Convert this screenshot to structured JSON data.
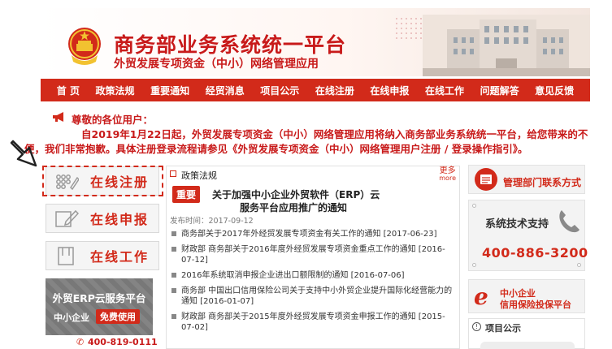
{
  "header": {
    "title": "商务部业务系统统一平台",
    "subtitle": "外贸发展专项资金（中小）网络管理应用"
  },
  "nav": {
    "items": [
      "首 页",
      "政策法规",
      "重要通知",
      "经贸消息",
      "项目公示",
      "在线注册",
      "在线申报",
      "在线工作",
      "问题解答",
      "意见反馈"
    ]
  },
  "notice": {
    "greeting": "尊敬的各位用户：",
    "line1": "自2019年1月22日起，外贸发展专项资金（中小）网络管理应用将纳入商务部业务系统统一平台，给您带来的不",
    "line2": "便，我们非常抱歉。具体注册登录流程请参见《外贸发展专项资金（中小）网络管理用户注册 / 登录操作指引》。"
  },
  "sidebar": {
    "register": "在线注册",
    "apply": "在线申报",
    "work": "在线工作"
  },
  "erp_banner": {
    "title": "外贸ERP云服务平台",
    "sme": "中小企业",
    "free": "免费使用",
    "phone": "400-819-0111"
  },
  "policy": {
    "heading": "政策法规",
    "more_cn": "更多",
    "more_en": "more",
    "badge": "重要",
    "headline_line1": "关于加强中小企业外贸软件（ERP）云",
    "headline_line2": "服务平台应用推广的通知",
    "pubdate": "发布时间：2017-09-12",
    "items": [
      "商务部关于2017年外经贸发展专项资金有关工作的通知 [2017-06-23]",
      "财政部 商务部关于2016年度外经贸发展专项资金重点工作的通知 [2016-07-12]",
      "2016年系统取消申报企业进出口额限制的通知 [2016-07-06]",
      "商务部 中国出口信用保险公司关于支持中小外贸企业提升国际化经营能力的通知 [2016-01-07]",
      "财政部 商务部关于2015年度外经贸发展专项资金申报工作的通知 [2015-07-02]"
    ]
  },
  "right": {
    "contact": "管理部门联系方式",
    "support_title": "系统技术支持",
    "support_phone": "400-886-3200",
    "sme_line1": "中小企业",
    "sme_line2": "信用保险投保平台",
    "sme_letter": "e",
    "projects_title": "项目公示"
  },
  "colors": {
    "brand_red": "#d22a1a",
    "text_red": "#c81a1a"
  }
}
